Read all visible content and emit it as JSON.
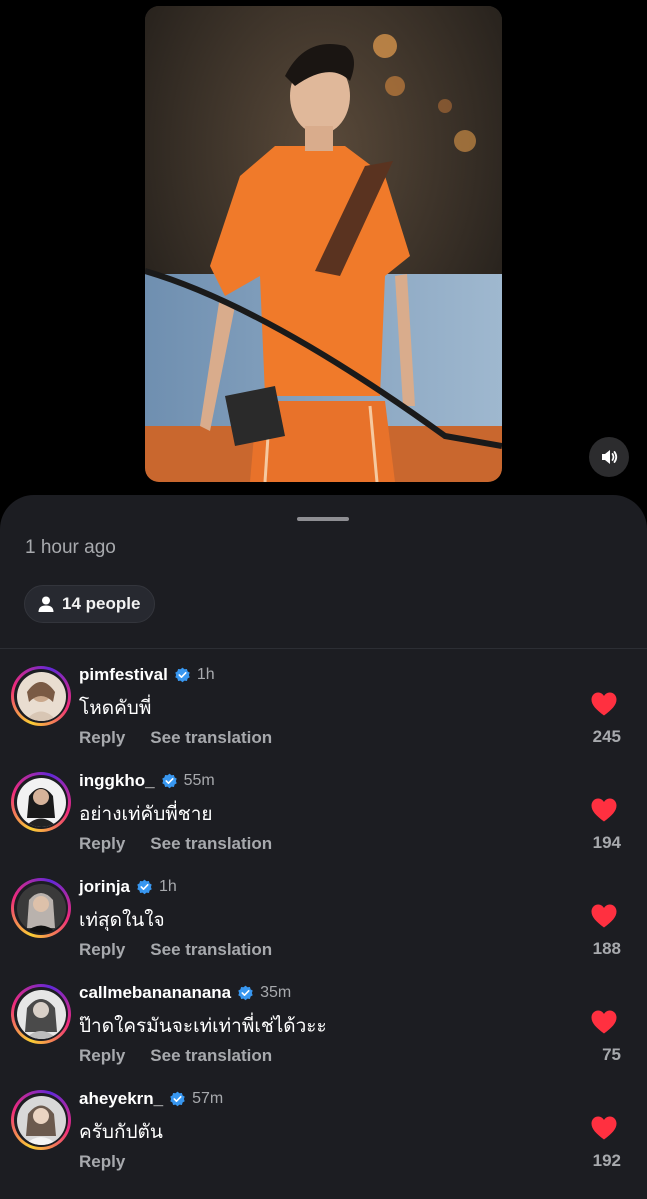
{
  "sheet": {
    "timestamp": "1 hour ago",
    "audience_label": "14 people"
  },
  "colors": {
    "heart": "#ff3040",
    "verified": "#3897f0",
    "sheet_bg": "#1c1d22"
  },
  "icons": {
    "mute": "speaker-icon",
    "audience": "person-icon",
    "like": "heart-icon",
    "verified": "verified-badge-icon"
  },
  "comments": [
    {
      "username": "pimfestival",
      "time": "1h",
      "text": "โหดคับพี่",
      "reply": "Reply",
      "translate": "See translation",
      "likes": "245"
    },
    {
      "username": "inggkho_",
      "time": "55m",
      "text": "อย่างเท่คับพี่ชาย",
      "reply": "Reply",
      "translate": "See translation",
      "likes": "194"
    },
    {
      "username": "jorinja",
      "time": "1h",
      "text": "เท่สุดในใจ",
      "reply": "Reply",
      "translate": "See translation",
      "likes": "188"
    },
    {
      "username": "callmebanananana",
      "time": "35m",
      "text": "ป๊าดใครมันจะเท่เท่าพี่เช่ได้วะะ",
      "reply": "Reply",
      "translate": "See translation",
      "likes": "75"
    },
    {
      "username": "aheyekrn_",
      "time": "57m",
      "text": "ครับกัปตัน",
      "reply": "Reply",
      "translate": "",
      "likes": "192"
    }
  ]
}
